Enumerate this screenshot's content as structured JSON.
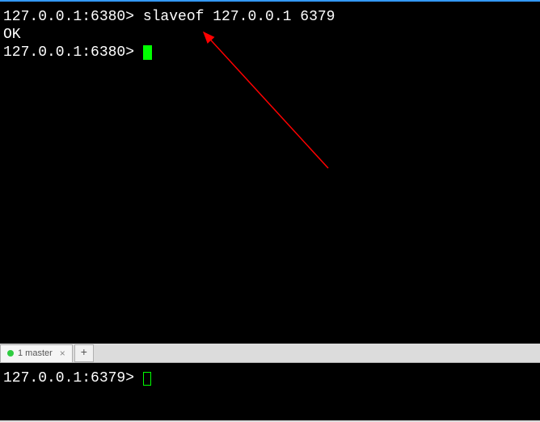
{
  "terminal_top": {
    "line1_prompt": "127.0.0.1:6380>",
    "line1_command": " slaveof 127.0.0.1 6379",
    "line2_response": "OK",
    "line3_prompt": "127.0.0.1:6380> "
  },
  "tab": {
    "label": "1 master",
    "close": "×",
    "add": "+"
  },
  "terminal_bottom": {
    "line1_prompt": "127.0.0.1:6379> "
  },
  "colors": {
    "terminal_bg": "#000000",
    "text": "#ffffff",
    "cursor": "#00ff00",
    "arrow": "#ff0000",
    "tab_dot": "#2ecc40"
  }
}
